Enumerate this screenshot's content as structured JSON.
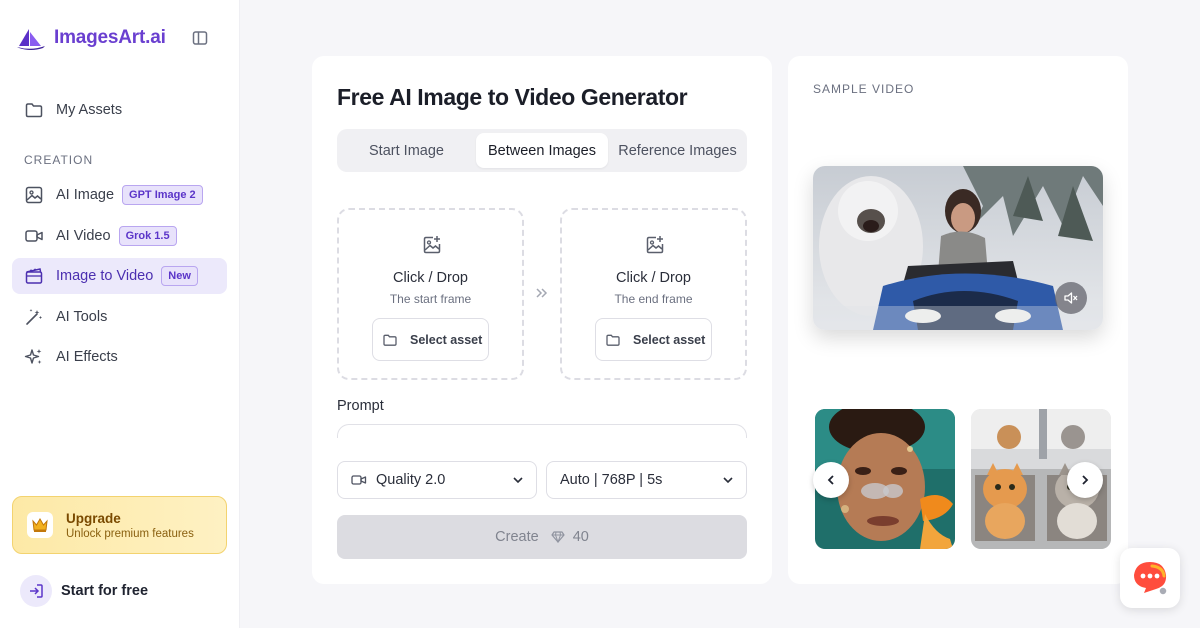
{
  "brand": {
    "name": "ImagesArt.ai"
  },
  "sidebar": {
    "my_assets": "My Assets",
    "section_label": "CREATION",
    "items": [
      {
        "label": "AI Image",
        "badge": "GPT Image 2"
      },
      {
        "label": "AI Video",
        "badge": "Grok 1.5"
      },
      {
        "label": "Image to Video",
        "badge": "New"
      },
      {
        "label": "AI Tools"
      },
      {
        "label": "AI Effects"
      }
    ],
    "upgrade": {
      "title": "Upgrade",
      "subtitle": "Unlock premium features"
    },
    "start_free": "Start for free"
  },
  "main": {
    "title": "Free AI Image to Video Generator",
    "tabs": [
      "Start Image",
      "Between Images",
      "Reference Images"
    ],
    "active_tab": "Between Images",
    "start_frame": {
      "title": "Click / Drop",
      "subtitle": "The start frame",
      "button": "Select asset"
    },
    "end_frame": {
      "title": "Click / Drop",
      "subtitle": "The end frame",
      "button": "Select asset"
    },
    "prompt_label": "Prompt",
    "quality": "Quality 2.0",
    "settings": "Auto | 768P | 5s",
    "create_label": "Create",
    "create_cost": "40"
  },
  "sample": {
    "label": "SAMPLE VIDEO"
  },
  "colors": {
    "accent": "#6a3fd0",
    "active_bg": "#ece9fb",
    "upgrade_bg": "#fde9a6",
    "chat": "#ff4d3d"
  },
  "icons": [
    "sidebar-toggle-icon",
    "folder-icon",
    "image-icon",
    "video-camera-icon",
    "film-icon",
    "magic-wand-icon",
    "sparkles-icon",
    "crown-icon",
    "login-icon",
    "image-plus-icon",
    "double-chevron-icon",
    "chevron-down-icon",
    "diamond-icon",
    "mute-icon",
    "chevron-left-icon",
    "chevron-right-icon",
    "chat-icon"
  ]
}
